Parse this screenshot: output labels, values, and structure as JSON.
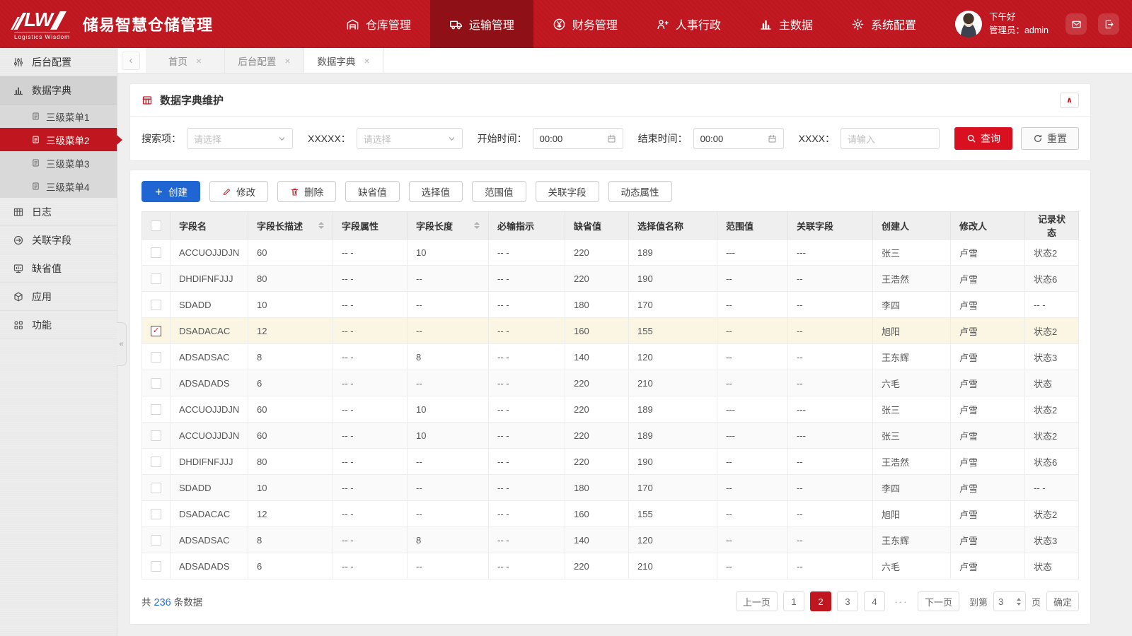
{
  "header": {
    "logo_text": "LW",
    "logo_caption": "Logistics Wisdom",
    "app_title": "储易智慧仓储管理",
    "nav": [
      {
        "label": "仓库管理",
        "icon": "warehouse-icon",
        "active": false
      },
      {
        "label": "运输管理",
        "icon": "truck-icon",
        "active": true
      },
      {
        "label": "财务管理",
        "icon": "finance-icon",
        "active": false
      },
      {
        "label": "人事行政",
        "icon": "hr-icon",
        "active": false
      },
      {
        "label": "主数据",
        "icon": "data-icon",
        "active": false
      },
      {
        "label": "系统配置",
        "icon": "gear-icon",
        "active": false
      }
    ],
    "greeting": "下午好",
    "user_role_label": "管理员：admin",
    "action_icons": [
      "envelope-icon",
      "logout-icon"
    ]
  },
  "sidebar": {
    "items": [
      {
        "label": "后台配置",
        "icon": "sliders-icon"
      },
      {
        "label": "数据字典",
        "icon": "bar-chart-icon",
        "expanded": true,
        "children": [
          {
            "label": "三级菜单1",
            "active": false
          },
          {
            "label": "三级菜单2",
            "active": true
          },
          {
            "label": "三级菜单3",
            "active": false
          },
          {
            "label": "三级菜单4",
            "active": false
          }
        ]
      },
      {
        "label": "日志",
        "icon": "log-grid-icon"
      },
      {
        "label": "关联字段",
        "icon": "link-icon"
      },
      {
        "label": "缺省值",
        "icon": "monitor-icon"
      },
      {
        "label": "应用",
        "icon": "cube-icon"
      },
      {
        "label": "功能",
        "icon": "apps-icon"
      }
    ],
    "collapse_glyph": "«"
  },
  "tabs": {
    "back_glyph": "‹",
    "close_glyph": "×",
    "items": [
      {
        "label": "首页",
        "active": false
      },
      {
        "label": "后台配置",
        "active": false
      },
      {
        "label": "数据字典",
        "active": true
      }
    ]
  },
  "panel": {
    "title": "数据字典维护",
    "icon": "table-grid-icon",
    "collapse_glyph": "∧"
  },
  "filters": {
    "search_item": {
      "label": "搜索项：",
      "placeholder": "请选择"
    },
    "xxxxx": {
      "label": "XXXXX：",
      "placeholder": "请选择"
    },
    "start_time": {
      "label": "开始时间：",
      "value": "00:00"
    },
    "end_time": {
      "label": "结束时间：",
      "value": "00:00"
    },
    "xxxx": {
      "label": "XXXX：",
      "placeholder": "请输入"
    },
    "query_label": "查询",
    "reset_label": "重置"
  },
  "toolbar": {
    "buttons": [
      {
        "label": "创建",
        "icon": "plus-icon",
        "style": "primary"
      },
      {
        "label": "修改",
        "icon": "pencil-icon",
        "style": "default"
      },
      {
        "label": "删除",
        "icon": "trash-icon",
        "style": "default"
      },
      {
        "label": "缺省值",
        "style": "default"
      },
      {
        "label": "选择值",
        "style": "default"
      },
      {
        "label": "范围值",
        "style": "default"
      },
      {
        "label": "关联字段",
        "style": "default"
      },
      {
        "label": "动态属性",
        "style": "default"
      }
    ]
  },
  "table": {
    "columns": [
      {
        "label": "字段名",
        "sortable": false
      },
      {
        "label": "字段长描述",
        "sortable": true
      },
      {
        "label": "字段属性",
        "sortable": false
      },
      {
        "label": "字段长度",
        "sortable": true
      },
      {
        "label": "必输指示",
        "sortable": false
      },
      {
        "label": "缺省值",
        "sortable": false
      },
      {
        "label": "选择值名称",
        "sortable": false
      },
      {
        "label": "范围值",
        "sortable": false
      },
      {
        "label": "关联字段",
        "sortable": false
      },
      {
        "label": "创建人",
        "sortable": false
      },
      {
        "label": "修改人",
        "sortable": false
      },
      {
        "label": "记录状态",
        "sortable": false
      }
    ],
    "checked_row": 3,
    "rows": [
      [
        "ACCUOJJDJN",
        "60",
        "-- -",
        "10",
        "-- -",
        "220",
        "189",
        "---",
        "---",
        "张三",
        "卢雪",
        "状态2"
      ],
      [
        "DHDIFNFJJJ",
        "80",
        "-- -",
        "--",
        "-- -",
        "220",
        "190",
        "--",
        "--",
        "王浩然",
        "卢雪",
        "状态6"
      ],
      [
        "SDADD",
        "10",
        "-- -",
        "--",
        "-- -",
        "180",
        "170",
        "--",
        "--",
        "李四",
        "卢雪",
        "-- -"
      ],
      [
        "DSADACAC",
        "12",
        "-- -",
        "--",
        "-- -",
        "160",
        "155",
        "--",
        "--",
        "旭阳",
        "卢雪",
        "状态2"
      ],
      [
        "ADSADSAC",
        "8",
        "-- -",
        "8",
        "-- -",
        "140",
        "120",
        "--",
        "--",
        "王东辉",
        "卢雪",
        "状态3"
      ],
      [
        "ADSADADS",
        "6",
        "-- -",
        "--",
        "-- -",
        "220",
        "210",
        "--",
        "--",
        "六毛",
        "卢雪",
        "状态"
      ],
      [
        "ACCUOJJDJN",
        "60",
        "-- -",
        "10",
        "-- -",
        "220",
        "189",
        "---",
        "---",
        "张三",
        "卢雪",
        "状态2"
      ],
      [
        "ACCUOJJDJN",
        "60",
        "-- -",
        "10",
        "-- -",
        "220",
        "189",
        "---",
        "---",
        "张三",
        "卢雪",
        "状态2"
      ],
      [
        "DHDIFNFJJJ",
        "80",
        "-- -",
        "--",
        "-- -",
        "220",
        "190",
        "--",
        "--",
        "王浩然",
        "卢雪",
        "状态6"
      ],
      [
        "SDADD",
        "10",
        "-- -",
        "--",
        "-- -",
        "180",
        "170",
        "--",
        "--",
        "李四",
        "卢雪",
        "-- -"
      ],
      [
        "DSADACAC",
        "12",
        "-- -",
        "--",
        "-- -",
        "160",
        "155",
        "--",
        "--",
        "旭阳",
        "卢雪",
        "状态2"
      ],
      [
        "ADSADSAC",
        "8",
        "-- -",
        "8",
        "-- -",
        "140",
        "120",
        "--",
        "--",
        "王东辉",
        "卢雪",
        "状态3"
      ],
      [
        "ADSADADS",
        "6",
        "-- -",
        "--",
        "-- -",
        "220",
        "210",
        "--",
        "--",
        "六毛",
        "卢雪",
        "状态"
      ]
    ]
  },
  "footer": {
    "total_prefix": "共",
    "total_count": "236",
    "total_suffix": "条数据",
    "pagination": {
      "prev": "上一页",
      "pages": [
        "1",
        "2",
        "3",
        "4"
      ],
      "active_page": "2",
      "ellipsis": "···",
      "next": "下一页",
      "goto_prefix": "到第",
      "goto_value": "3",
      "goto_suffix": "页",
      "confirm": "确定"
    }
  },
  "colors": {
    "brand_red": "#bf161f",
    "nav_active_red": "#8f1016",
    "query_red": "#d8101f",
    "primary_blue": "#1f66d2",
    "link_blue": "#2a6fdb",
    "selected_row_yellow": "#fbf6e3"
  }
}
